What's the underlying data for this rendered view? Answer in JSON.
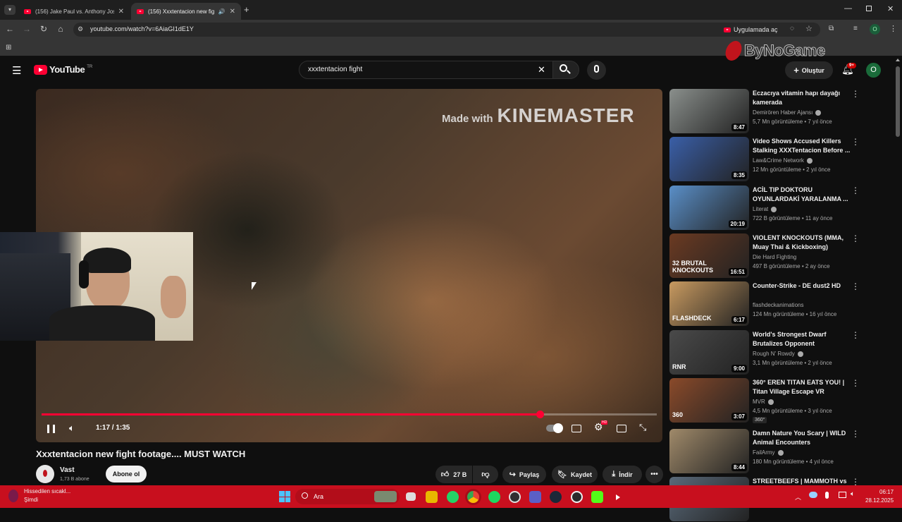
{
  "browser": {
    "tabs": [
      {
        "label": "(156) Jake Paul vs. Anthony Jos"
      },
      {
        "label": "(156) Xxxtentacion new figh"
      }
    ],
    "url": "youtube.com/watch?v=6AiaGI1dE1Y",
    "open_in_app": "Uygulamada aç",
    "profile_initial": "O"
  },
  "watermark": "ByNoGame",
  "youtube": {
    "logo_text": "YouTube",
    "region": "TR",
    "search_value": "xxxtentacion fight",
    "create_label": "Oluştur",
    "notif_count": "9+",
    "avatar_initial": "O"
  },
  "player": {
    "overlay_made_with": "Made with",
    "overlay_brand": "KINEMASTER",
    "time": "1:17 / 1:35",
    "progress_fraction": 0.81,
    "hd_badge": "HD"
  },
  "video": {
    "title": "Xxxtentacion new fight footage.... MUST WATCH",
    "channel": "Vast",
    "subscribers": "1,73 B abone",
    "subscribe_label": "Abone ol",
    "likes": "27 B",
    "share_label": "Paylaş",
    "save_label": "Kaydet",
    "download_label": "İndir"
  },
  "recommendations": [
    {
      "title": "Eczacıya vitamin hapı dayağı kamerada",
      "channel": "Demirören Haber Ajansı",
      "verified": true,
      "meta": "5,7 Mn görüntüleme • 7 yıl önce",
      "duration": "8:47",
      "color": "#8a8f8c"
    },
    {
      "title": "Video Shows Accused Killers Stalking XXXTentacion Before ...",
      "channel": "Law&Crime Network",
      "verified": true,
      "meta": "12 Mn görüntüleme • 2 yıl önce",
      "duration": "8:35",
      "color": "#3a5fa8"
    },
    {
      "title": "ACİL TIP DOKTORU OYUNLARDAKİ YARALANMA ...",
      "channel": "Literat",
      "verified": true,
      "meta": "722 B görüntüleme • 11 ay önce",
      "duration": "20:19",
      "color": "#5a8fc8"
    },
    {
      "title": "VIOLENT KNOCKOUTS (MMA, Muay Thai & Kickboxing)",
      "channel": "Die Hard Fighting",
      "verified": false,
      "meta": "497 B görüntüleme • 2 ay önce",
      "duration": "16:51",
      "color": "#6b3a22",
      "thumb_text": "32 BRUTAL KNOCKOUTS"
    },
    {
      "title": "Counter-Strike - DE dust2 HD",
      "channel": "flashdeckanimations",
      "verified": false,
      "meta": "124 Mn görüntüleme • 16 yıl önce",
      "duration": "6:17",
      "color": "#c89a60",
      "thumb_text": "FLASHDECK"
    },
    {
      "title": "World's Strongest Dwarf Brutalizes Opponent",
      "channel": "Rough N' Rowdy",
      "verified": true,
      "meta": "3,1 Mn görüntüleme • 2 yıl önce",
      "duration": "9:00",
      "color": "#4a4a4a",
      "thumb_text": "RNR"
    },
    {
      "title": "360° EREN TITAN EATS YOU! | Titan Village Escape VR",
      "channel": "MVR",
      "verified": true,
      "meta": "4,5 Mn görüntüleme • 3 yıl önce",
      "duration": "3:07",
      "color": "#8a4a2a",
      "thumb_text": "360",
      "badge": "360°"
    },
    {
      "title": "Damn Nature You Scary | WILD Animal Encounters",
      "channel": "FailArmy",
      "verified": true,
      "meta": "180 Mn görüntüleme • 4 yıl önce",
      "duration": "8:44",
      "color": "#a08a6a"
    },
    {
      "title": "STREETBEEFS | MAMMOTH vs",
      "channel": "",
      "verified": false,
      "meta": "",
      "duration": "",
      "color": "#5a6a7a"
    }
  ],
  "taskbar": {
    "weather": "Hissedilen sıcakl...",
    "weather_sub": "Şimdi",
    "search_placeholder": "Ara",
    "time": "06:17",
    "date": "28.12.2025"
  },
  "colors": {
    "accent": "#ff0033",
    "taskbar": "#c80f1e"
  }
}
